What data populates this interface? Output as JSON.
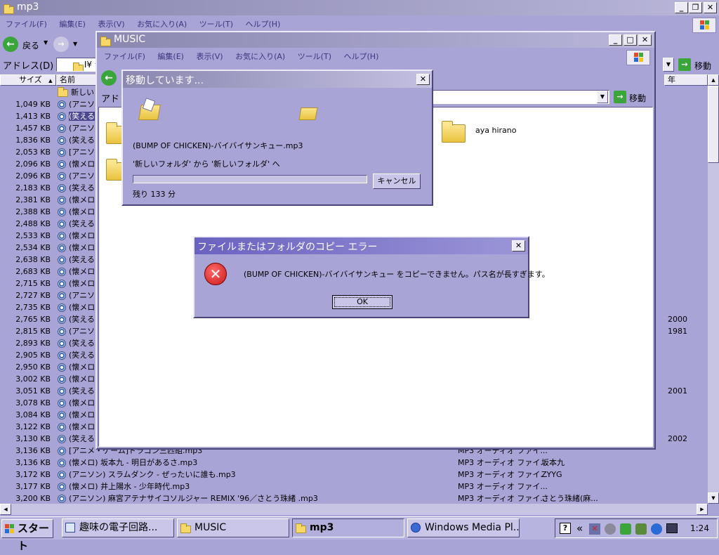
{
  "bg_window": {
    "title": "mp3",
    "menu": [
      "ファイル(F)",
      "編集(E)",
      "表示(V)",
      "お気に入り(A)",
      "ツール(T)",
      "ヘルプ(H)"
    ],
    "back_label": "戻る",
    "address_label": "アドレス(D)",
    "address_value": "I¥ 音",
    "go_label": "移動",
    "columns": {
      "size": "サイズ",
      "name": "名前",
      "year": "年"
    },
    "rows": [
      {
        "size": "",
        "name": "新しい",
        "folder": true
      },
      {
        "size": "1,049 KB",
        "name": "(アニソ"
      },
      {
        "size": "1,413 KB",
        "name": "(笑える",
        "selected": true
      },
      {
        "size": "1,457 KB",
        "name": "(アニソ"
      },
      {
        "size": "1,836 KB",
        "name": "(笑える"
      },
      {
        "size": "2,053 KB",
        "name": "[アニソ"
      },
      {
        "size": "2,096 KB",
        "name": "(懐メロ"
      },
      {
        "size": "2,096 KB",
        "name": "(アニソ"
      },
      {
        "size": "2,183 KB",
        "name": "(笑える"
      },
      {
        "size": "2,381 KB",
        "name": "(懐メロ"
      },
      {
        "size": "2,388 KB",
        "name": "(懐メロ"
      },
      {
        "size": "2,488 KB",
        "name": "(笑える"
      },
      {
        "size": "2,533 KB",
        "name": "(懐メロ"
      },
      {
        "size": "2,534 KB",
        "name": "(懐メロ"
      },
      {
        "size": "2,638 KB",
        "name": "(笑える"
      },
      {
        "size": "2,683 KB",
        "name": "(懐メロ"
      },
      {
        "size": "2,715 KB",
        "name": "(懐メロ"
      },
      {
        "size": "2,727 KB",
        "name": "(アニソ"
      },
      {
        "size": "2,735 KB",
        "name": "(懐メロ"
      },
      {
        "size": "2,765 KB",
        "name": "(笑える",
        "year": "2000"
      },
      {
        "size": "2,815 KB",
        "name": "(アニソ",
        "year": "1981"
      },
      {
        "size": "2,893 KB",
        "name": "(笑える"
      },
      {
        "size": "2,905 KB",
        "name": "(笑える"
      },
      {
        "size": "2,950 KB",
        "name": "(懐メロ"
      },
      {
        "size": "3,002 KB",
        "name": "(懐メロ"
      },
      {
        "size": "3,051 KB",
        "name": "(笑える",
        "year": "2001"
      },
      {
        "size": "3,078 KB",
        "name": "(懐メロ"
      },
      {
        "size": "3,084 KB",
        "name": "(懐メロ"
      },
      {
        "size": "3,122 KB",
        "name": "(懐メロ"
      },
      {
        "size": "3,130 KB",
        "name": "(笑える",
        "year": "2002"
      },
      {
        "size": "3,136 KB",
        "name": "[アニメ・ゲーム]ドラゴン三匹組.mp3",
        "type": "MP3 オーディオ ファイ..."
      },
      {
        "size": "3,136 KB",
        "name": "(懐メロ) 坂本九 - 明日があるさ.mp3",
        "type": "MP3 オーディオ ファイ...",
        "artist": "坂本九"
      },
      {
        "size": "3,172 KB",
        "name": "(アニソン) スラムダンク - ぜったいに誰も.mp3",
        "type": "MP3 オーディオ ファイ...",
        "artist": "ZYYG"
      },
      {
        "size": "3,177 KB",
        "name": "(懐メロ) 井上陽水 - 少年時代.mp3",
        "type": "MP3 オーディオ ファイ..."
      },
      {
        "size": "3,200 KB",
        "name": "(アニソン) 麻宮アテナサイコソルジャー REMIX '96／さとう珠緒 .mp3",
        "type": "MP3 オーディオ ファイ...",
        "artist": "さとう珠緒(麻..."
      }
    ]
  },
  "music_window": {
    "title": "MUSIC",
    "menu": [
      "ファイル(F)",
      "編集(E)",
      "表示(V)",
      "お気に入り(A)",
      "ツール(T)",
      "ヘルプ(H)"
    ],
    "address_label": "アドレ",
    "go_label": "移動",
    "folder_label": "aya hirano"
  },
  "move_dialog": {
    "title": "移動しています...",
    "filename": "(BUMP OF CHICKEN)-バイバイサンキュー.mp3",
    "from_to": "'新しいフォルダ' から '新しいフォルダ' へ",
    "progress": 0,
    "cancel_label": "キャンセル",
    "remaining": "残り 133 分"
  },
  "error_dialog": {
    "title": "ファイルまたはフォルダのコピー エラー",
    "message": "(BUMP OF CHICKEN)-バイバイサンキュー をコピーできません。パス名が長すぎます。",
    "ok_label": "OK"
  },
  "taskbar": {
    "start_label": "スタート",
    "tasks": [
      {
        "label": "趣味の電子回路..."
      },
      {
        "label": "MUSIC"
      },
      {
        "label": "mp3",
        "active": true
      },
      {
        "label": "Windows Media Pl..."
      }
    ],
    "clock": "1:24",
    "tray_arrow": "«",
    "help_label": "?"
  },
  "colors": {
    "desktop_bg": "#a9a4d6",
    "titlebar": "#7a72c4",
    "error_red": "#d42020"
  }
}
